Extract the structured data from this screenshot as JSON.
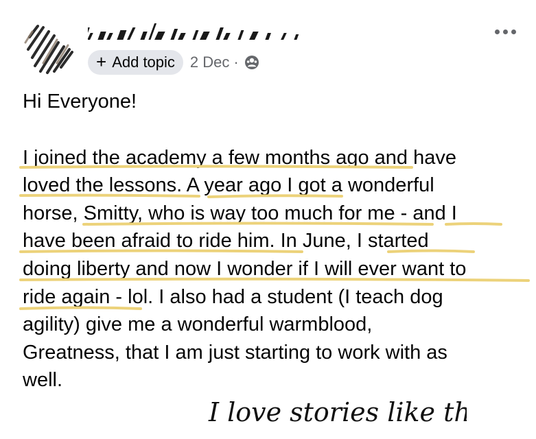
{
  "post": {
    "author": {
      "name_redacted": true,
      "avatar_redacted": true
    },
    "more_options_icon": "more-horizontal-icon",
    "meta": {
      "add_topic_icon": "plus-icon",
      "add_topic_label": "Add topic",
      "timestamp": "2 Dec",
      "separator": "·",
      "privacy_icon": "group-privacy-icon"
    },
    "body": {
      "lines": [
        "Hi Everyone!",
        "",
        "I joined the academy a few months ago and have",
        "loved the lessons.  A year ago I got a wonderful",
        "horse, Smitty, who is way too much for me - and I",
        "have been afraid to ride him.  In June, I started",
        "doing liberty and now I wonder if I will ever want to",
        "ride again - lol.  I also had a student (I teach dog",
        "agility) give me a wonderful warmblood,",
        "Greatness, that I am just starting to work with as",
        "well."
      ]
    }
  },
  "annotation": {
    "handwritten_text": "I love stories like this!",
    "highlight_color": "#ecd27a"
  }
}
